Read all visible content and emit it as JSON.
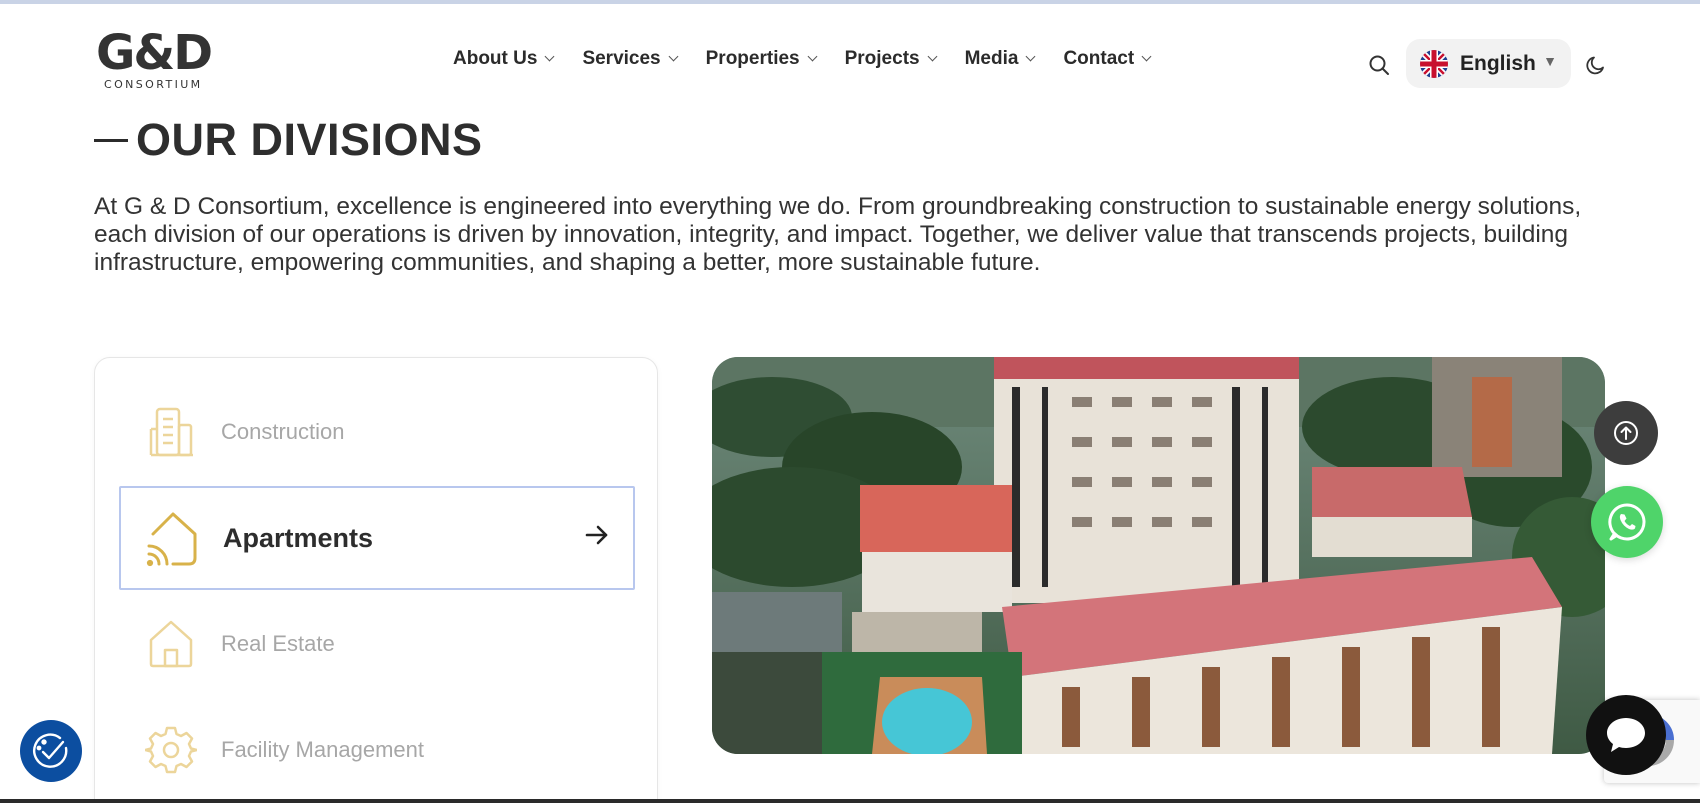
{
  "header": {
    "logo_main": "G&D",
    "logo_sub": "CONSORTIUM",
    "nav": [
      {
        "label": "About Us"
      },
      {
        "label": "Services"
      },
      {
        "label": "Properties"
      },
      {
        "label": "Projects"
      },
      {
        "label": "Media"
      },
      {
        "label": "Contact"
      }
    ],
    "search_icon": "search-icon",
    "language": {
      "label": "English",
      "flag_icon": "uk-flag-icon",
      "caret": "▼"
    },
    "theme_icon": "moon-icon"
  },
  "section": {
    "title": "OUR DIVISIONS",
    "intro": "At G & D Consortium, excellence is engineered into everything we do. From groundbreaking construction to sustainable energy solutions, each division of our operations is driven by innovation, integrity, and impact. Together, we deliver value that transcends projects, building infrastructure, empowering communities, and shaping a better, more sustainable future."
  },
  "divisions": {
    "items": [
      {
        "label": "Construction",
        "icon": "building-icon",
        "active": false
      },
      {
        "label": "Apartments",
        "icon": "smart-home-icon",
        "active": true
      },
      {
        "label": "Real Estate",
        "icon": "house-icon",
        "active": false
      },
      {
        "label": "Facility Management",
        "icon": "gear-icon",
        "active": false
      }
    ],
    "active_arrow_icon": "arrow-right-icon"
  },
  "floating": {
    "scroll_top_icon": "arrow-up-circle-icon",
    "whatsapp_icon": "whatsapp-icon",
    "chat_icon": "chat-bubble-icon",
    "accessibility_icon": "accessibility-icon"
  },
  "colors": {
    "accent_gold": "#d8b24a",
    "active_border": "#b8c7ee",
    "whatsapp_green": "#4fd46a",
    "accessibility_blue": "#0c4ea0"
  }
}
